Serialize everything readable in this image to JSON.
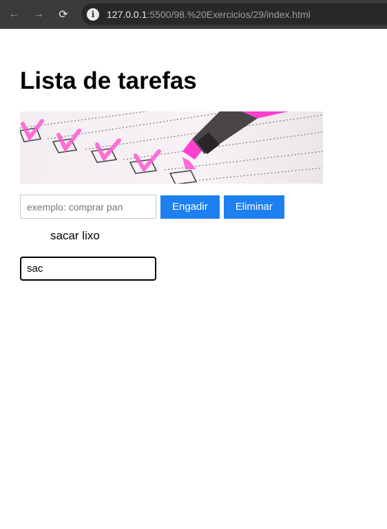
{
  "browser": {
    "url_host": "127.0.0.1",
    "url_rest": ":5500/98.%20Exercicios/29/index.html",
    "back_icon": "←",
    "forward_icon": "→",
    "reload_icon": "⟳",
    "info_icon": "i"
  },
  "page": {
    "title": "Lista de tarefas",
    "input": {
      "value": "",
      "placeholder": "exemplo: comprar pan"
    },
    "add_label": "Engadir",
    "remove_label": "Eliminar",
    "tasks": [
      {
        "label": "sacar lixo"
      }
    ],
    "edit_input": {
      "value": "sac"
    }
  },
  "colors": {
    "accent": "#1e7ff0",
    "chrome_bg": "#3b3b3b",
    "omnibox_bg": "#282828",
    "highlighter_pink": "#ff3fd0"
  }
}
